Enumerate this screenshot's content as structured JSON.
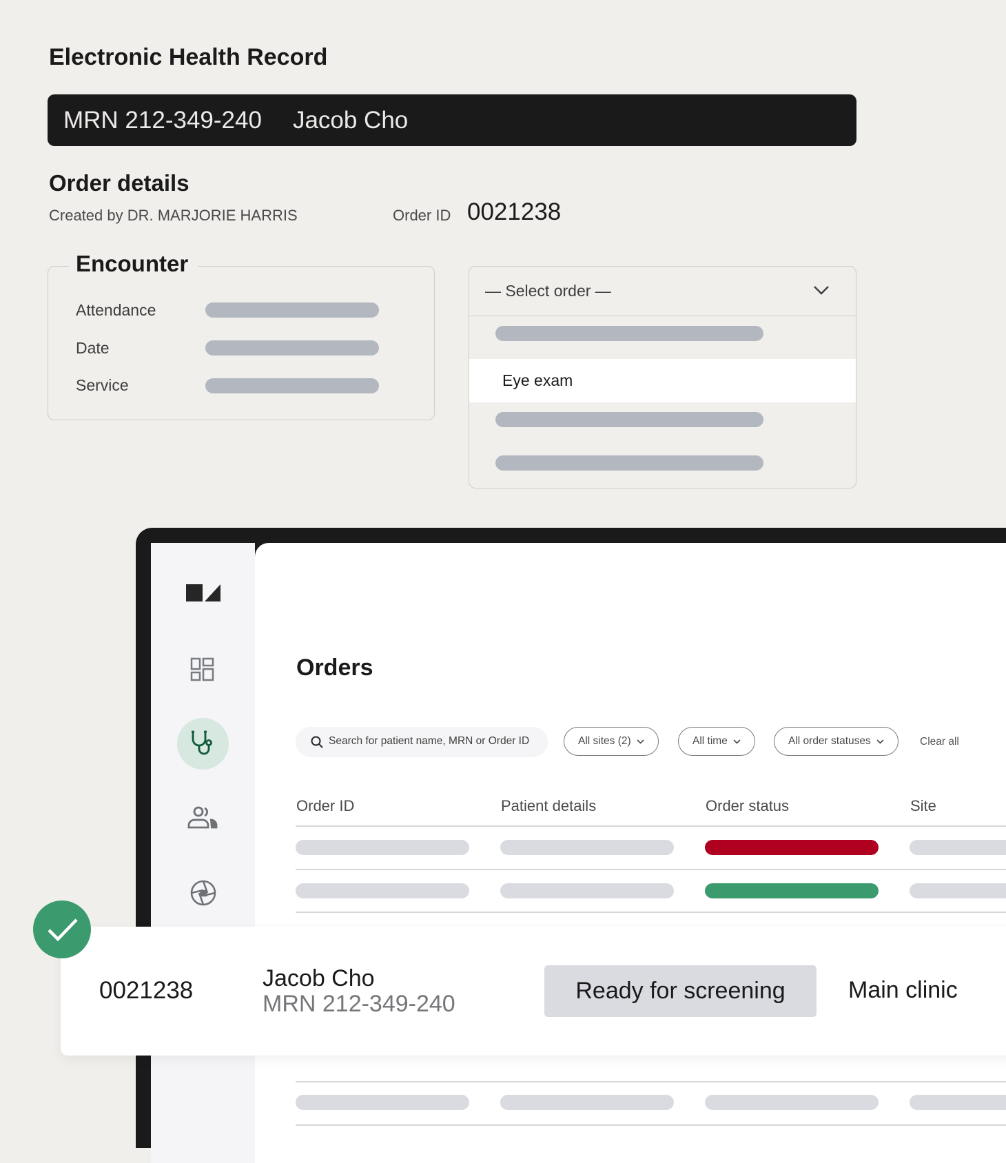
{
  "ehr": {
    "title": "Electronic Health Record",
    "mrn": "MRN 212-349-240",
    "patient_name": "Jacob Cho"
  },
  "order_details": {
    "title": "Order details",
    "created_by": "Created by DR. MARJORIE HARRIS",
    "order_id_label": "Order ID",
    "order_id_value": "0021238"
  },
  "encounter": {
    "title": "Encounter",
    "fields": [
      {
        "label": "Attendance"
      },
      {
        "label": "Date"
      },
      {
        "label": "Service"
      }
    ]
  },
  "order_select": {
    "placeholder": "— Select order —",
    "selected_option": "Eye exam",
    "icon": "chevron-down-icon"
  },
  "sidebar": {
    "logo": "app-logo",
    "items": [
      {
        "icon": "dashboard-grid-icon",
        "active": false
      },
      {
        "icon": "stethoscope-icon",
        "active": true
      },
      {
        "icon": "patients-icon",
        "active": false
      },
      {
        "icon": "aperture-icon",
        "active": false
      }
    ],
    "active_color": "#d6e8df",
    "active_icon_color": "#0f5a3a"
  },
  "orders": {
    "title": "Orders",
    "search_placeholder": "Search for patient name, MRN or Order ID",
    "filters": [
      {
        "label": "All sites (2)"
      },
      {
        "label": "All time"
      },
      {
        "label": "All order statuses"
      }
    ],
    "clear_all": "Clear all",
    "columns": [
      "Order ID",
      "Patient details",
      "Order status",
      "Site"
    ],
    "status_colors": {
      "error": "#b00020",
      "success": "#3b9a6e"
    }
  },
  "highlighted_order": {
    "order_id": "0021238",
    "patient_name": "Jacob Cho",
    "mrn": "MRN 212-349-240",
    "status": "Ready for screening",
    "site": "Main clinic",
    "check_color": "#3b9a6e"
  }
}
